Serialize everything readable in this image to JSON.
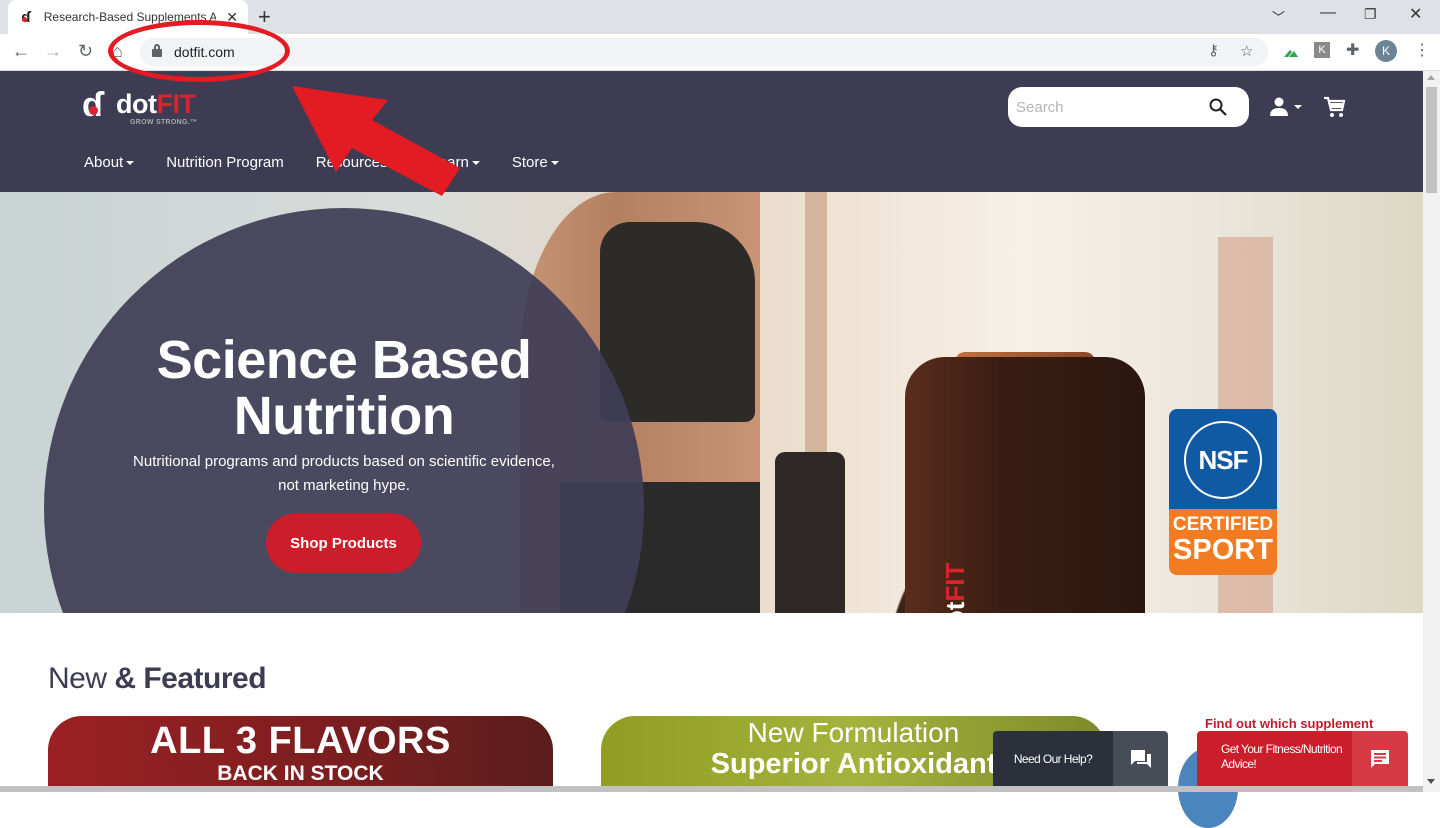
{
  "browser": {
    "tab": {
      "title": "Research-Based Supplements Ar...",
      "favicon": "dotfit-logo-icon"
    },
    "url": "dotfit.com",
    "window_controls": [
      "chevron-down-icon",
      "minimize-icon",
      "restore-icon",
      "close-icon"
    ],
    "toolbar_icons": [
      "key-icon",
      "star-icon",
      "extension-green-icon",
      "extension-k-icon",
      "puzzle-icon",
      "profile-avatar",
      "kebab-menu-icon"
    ],
    "profile_initial": "K",
    "extension_k": "K"
  },
  "site": {
    "logo": {
      "brand_prefix": "dot",
      "brand_suffix": "FIT",
      "tagline": "GROW STRONG.™"
    },
    "nav": [
      {
        "label": "About",
        "dropdown": true
      },
      {
        "label": "Nutrition Program",
        "dropdown": false
      },
      {
        "label": "Resources",
        "dropdown": true
      },
      {
        "label": "Learn",
        "dropdown": true
      },
      {
        "label": "Store",
        "dropdown": true
      }
    ],
    "search": {
      "placeholder": "Search",
      "value": ""
    },
    "hero": {
      "title_line1": "Science Based",
      "title_line2": "Nutrition",
      "subtitle_line1": "Nutritional programs and products based on scientific evidence,",
      "subtitle_line2": "not marketing hype.",
      "cta": "Shop Products",
      "jar_brand_prefix": "dot",
      "jar_brand_suffix": "FIT",
      "badge": {
        "top": "NSF",
        "line1": "CERTIFIED",
        "line2": "SPORT"
      }
    },
    "featured": {
      "title_light": "New",
      "title_bold": "& Featured",
      "cards": [
        {
          "headline": "ALL 3 FLAVORS",
          "sub": "BACK IN STOCK"
        },
        {
          "headline": "New Formulation",
          "sub": "Superior Antioxidant"
        },
        {
          "headline": "Find out which supplement"
        }
      ]
    },
    "widgets": {
      "help": "Need Our Help?",
      "advice": "Get Your Fitness/Nutrition Advice!"
    }
  },
  "colors": {
    "header_bg": "#3d3c53",
    "brand_red": "#cc1d2b",
    "annotation_red": "#e31b23",
    "nsf_blue": "#105aa4",
    "nsf_orange": "#f37b21"
  }
}
